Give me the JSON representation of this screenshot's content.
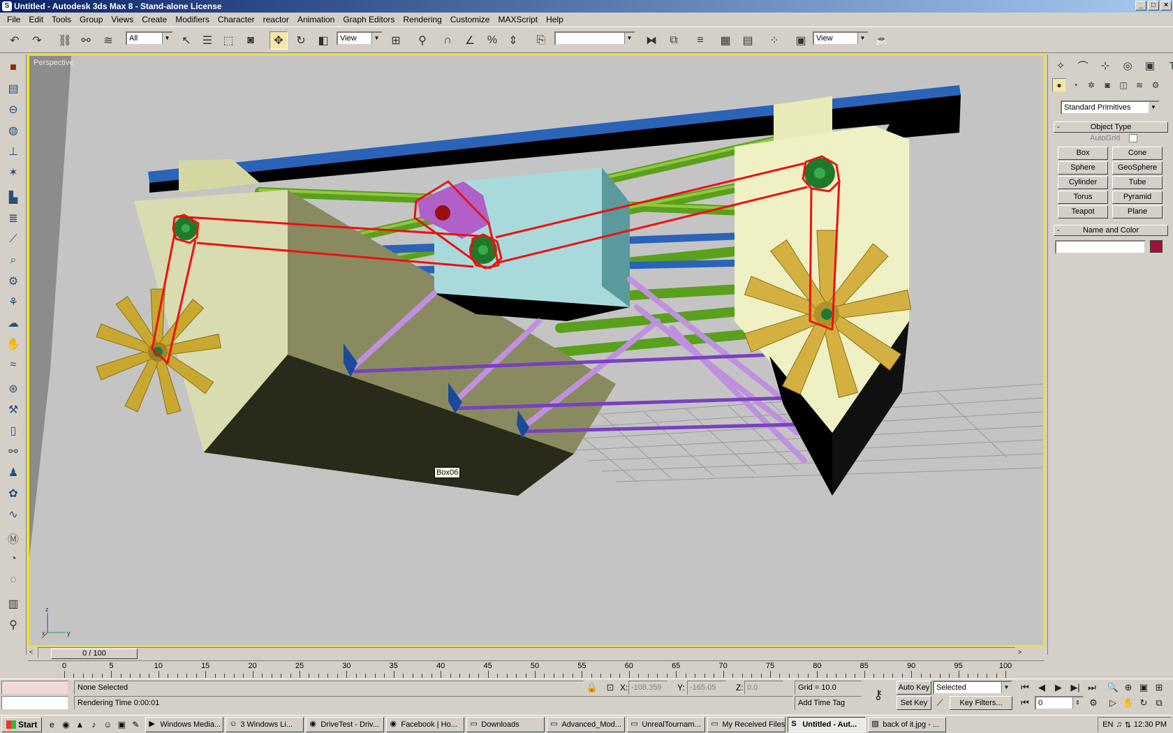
{
  "window": {
    "title": "Untitled - Autodesk 3ds Max 8 - Stand-alone License",
    "icon": "3ds-max-icon"
  },
  "menu": [
    "File",
    "Edit",
    "Tools",
    "Group",
    "Views",
    "Create",
    "Modifiers",
    "Character",
    "reactor",
    "Animation",
    "Graph Editors",
    "Rendering",
    "Customize",
    "MAXScript",
    "Help"
  ],
  "toolbar": {
    "selection_filter": "All",
    "reference_coord": "View",
    "named_selection": "",
    "render_view": "View"
  },
  "viewport": {
    "label": "Perspective",
    "tooltip": "Box06",
    "axis_x": "x",
    "axis_y": "y",
    "axis_z": "z"
  },
  "command_panel": {
    "category": "Standard Primitives",
    "object_type_title": "Object Type",
    "rollout_toggle": "-",
    "autogrid": "AutoGrid",
    "buttons": [
      "Box",
      "Cone",
      "Sphere",
      "GeoSphere",
      "Cylinder",
      "Tube",
      "Torus",
      "Pyramid",
      "Teapot",
      "Plane"
    ],
    "name_color_title": "Name and Color",
    "object_color": "#a0103a"
  },
  "timeline": {
    "frame": "0 / 100",
    "prev": "<",
    "next": ">",
    "ticks": [
      "0",
      "5",
      "10",
      "15",
      "20",
      "25",
      "30",
      "35",
      "40",
      "45",
      "50",
      "55",
      "60",
      "65",
      "70",
      "75",
      "80",
      "85",
      "90",
      "95",
      "100"
    ]
  },
  "status": {
    "selection": "None Selected",
    "prompt": "Rendering Time  0:00:01",
    "x_label": "X:",
    "x": "-108.359",
    "y_label": "Y:",
    "y": "-165.05",
    "z_label": "Z:",
    "z": "0.0",
    "grid": "Grid = 10.0",
    "add_time_tag": "Add Time Tag",
    "auto_key": "Auto Key",
    "set_key": "Set Key",
    "key_mode": "Selected",
    "key_filters": "Key Filters...",
    "current_frame": "0"
  },
  "taskbar": {
    "start": "Start",
    "tasks": [
      {
        "label": "Windows Media...",
        "icon": "media-player-icon"
      },
      {
        "label": "3 Windows Li...",
        "icon": "messenger-icon"
      },
      {
        "label": "DriveTest - Driv...",
        "icon": "firefox-icon"
      },
      {
        "label": "Facebook | Ho...",
        "icon": "firefox-icon"
      },
      {
        "label": "Downloads",
        "icon": "folder-icon"
      },
      {
        "label": "Advanced_Mod...",
        "icon": "folder-icon"
      },
      {
        "label": "UnrealTournam...",
        "icon": "folder-icon"
      },
      {
        "label": "My Received Files",
        "icon": "folder-icon"
      },
      {
        "label": "Untitled - Aut...",
        "icon": "3ds-max-icon",
        "active": true
      },
      {
        "label": "back of it.jpg - ...",
        "icon": "image-icon"
      }
    ],
    "lang": "EN",
    "clock": "12:30 PM"
  }
}
